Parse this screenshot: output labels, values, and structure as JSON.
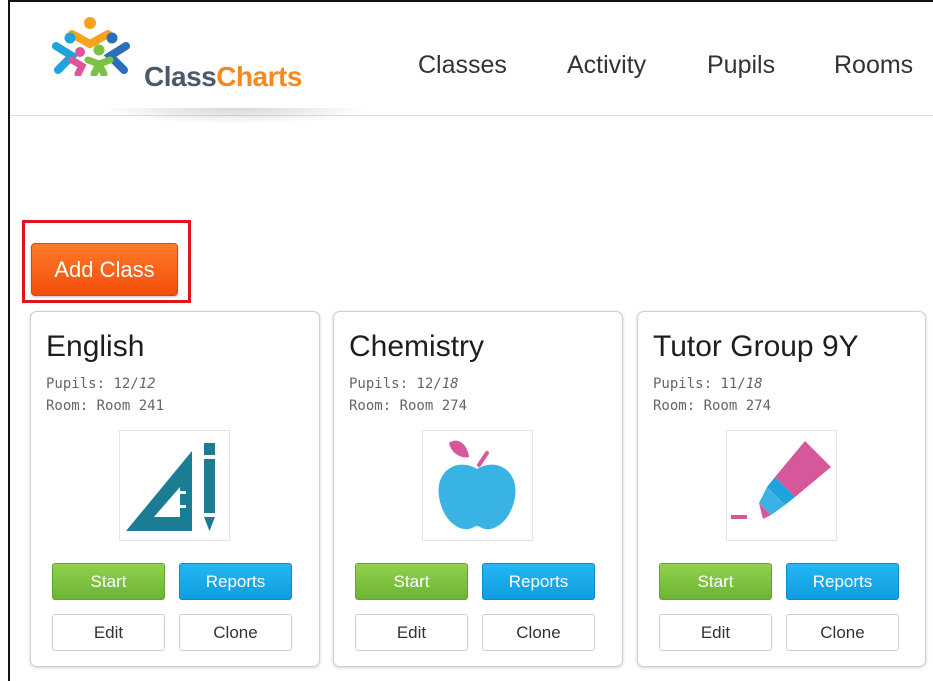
{
  "app": {
    "brand_part1": "Class",
    "brand_part2": "Charts"
  },
  "nav": {
    "items": [
      {
        "label": "Classes"
      },
      {
        "label": "Activity"
      },
      {
        "label": "Pupils"
      },
      {
        "label": "Rooms"
      }
    ]
  },
  "actions": {
    "add_class_label": "Add Class"
  },
  "classes": [
    {
      "name": "English",
      "pupils_label": "Pupils: ",
      "pupils_count": "12",
      "pupils_total": "12",
      "room_label": "Room: ",
      "room": "Room 241",
      "icon": "ruler-pencil-icon",
      "start_label": "Start",
      "reports_label": "Reports",
      "edit_label": "Edit",
      "clone_label": "Clone"
    },
    {
      "name": "Chemistry",
      "pupils_label": "Pupils: ",
      "pupils_count": "12",
      "pupils_total": "18",
      "room_label": "Room: ",
      "room": "Room 274",
      "icon": "apple-icon",
      "start_label": "Start",
      "reports_label": "Reports",
      "edit_label": "Edit",
      "clone_label": "Clone"
    },
    {
      "name": "Tutor Group 9Y",
      "pupils_label": "Pupils: ",
      "pupils_count": "11",
      "pupils_total": "18",
      "room_label": "Room: ",
      "room": "Room 274",
      "icon": "highlighter-icon",
      "start_label": "Start",
      "reports_label": "Reports",
      "edit_label": "Edit",
      "clone_label": "Clone"
    }
  ],
  "colors": {
    "accent_orange": "#f24e0c",
    "start_green": "#6db336",
    "reports_blue": "#0e9ee0",
    "highlight_red": "#e0141e",
    "icon_teal": "#1a7d93",
    "icon_apple_blue": "#38b3e4",
    "icon_pink": "#d6589a"
  }
}
